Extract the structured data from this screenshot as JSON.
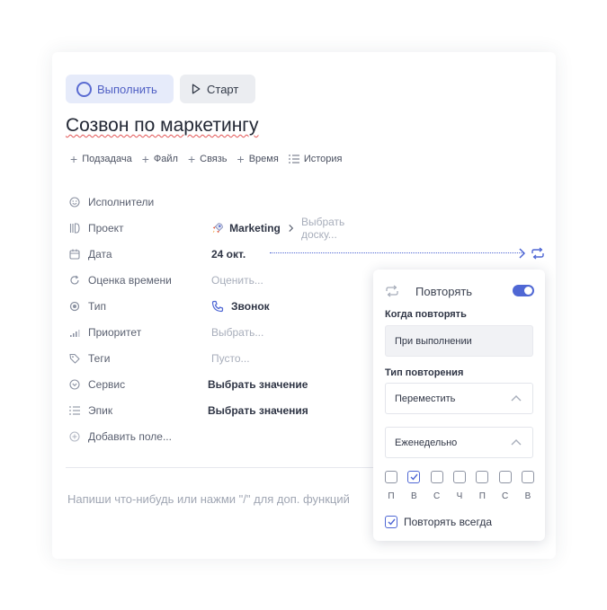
{
  "header": {
    "complete_label": "Выполнить",
    "start_label": "Старт"
  },
  "task": {
    "title": "Созвон по маркетингу"
  },
  "actions": [
    {
      "label": "Подзадача",
      "icon": "plus-icon"
    },
    {
      "label": "Файл",
      "icon": "plus-icon"
    },
    {
      "label": "Связь",
      "icon": "plus-icon"
    },
    {
      "label": "Время",
      "icon": "plus-icon"
    },
    {
      "label": "История",
      "icon": "list-icon"
    }
  ],
  "properties": {
    "assignees": {
      "label": "Исполнители"
    },
    "project": {
      "label": "Проект",
      "value": "Marketing",
      "board_placeholder": "Выбрать доску..."
    },
    "date": {
      "label": "Дата",
      "value": "24 окт."
    },
    "estimate": {
      "label": "Оценка времени",
      "value": "Оценить..."
    },
    "type": {
      "label": "Тип",
      "value": "Звонок"
    },
    "priority": {
      "label": "Приоритет",
      "value": "Выбрать..."
    },
    "tags": {
      "label": "Теги",
      "value": "Пусто..."
    },
    "service": {
      "label": "Сервис",
      "value": "Выбрать значение"
    },
    "epic": {
      "label": "Эпик",
      "value": "Выбрать значения"
    },
    "add_field": {
      "label": "Добавить поле..."
    }
  },
  "editor": {
    "placeholder": "Напиши что-нибудь или нажми \"/\" для доп. функций"
  },
  "repeat_popup": {
    "title": "Повторять",
    "enabled": true,
    "when_label": "Когда повторять",
    "when_value": "При выполнении",
    "type_label": "Тип повторения",
    "type_value": "Переместить",
    "frequency_value": "Еженедельно",
    "days": [
      {
        "label": "П",
        "checked": false
      },
      {
        "label": "В",
        "checked": true
      },
      {
        "label": "С",
        "checked": false
      },
      {
        "label": "Ч",
        "checked": false
      },
      {
        "label": "П",
        "checked": false
      },
      {
        "label": "С",
        "checked": false
      },
      {
        "label": "В",
        "checked": false
      }
    ],
    "always_label": "Повторять всегда",
    "always_checked": true
  },
  "colors": {
    "accent": "#4f67d4",
    "complete_bg": "#e6ebfa",
    "start_bg": "#ebedf1"
  }
}
